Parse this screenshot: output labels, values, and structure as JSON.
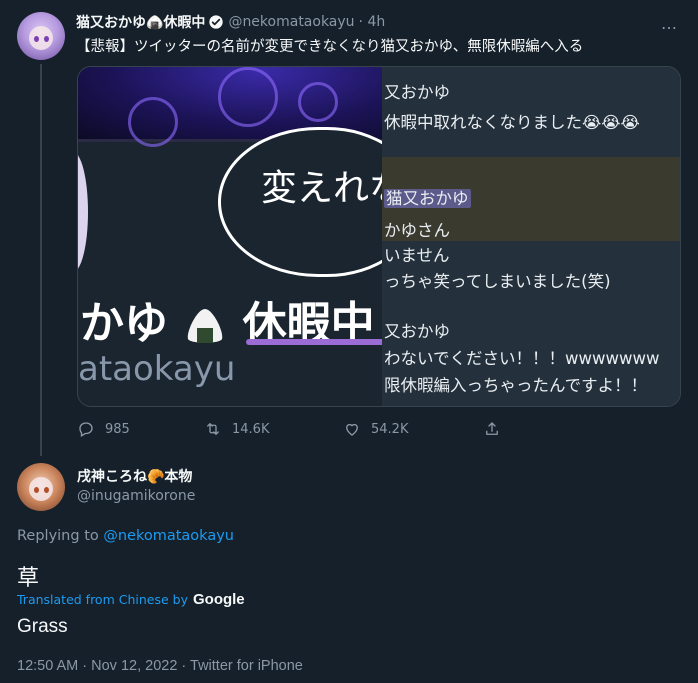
{
  "main_tweet": {
    "display_name": "猫又おかゆ🍙休暇中",
    "handle": "@nekomataokayu",
    "time": "· 4h",
    "text": "【悲報】ツイッターの名前が変更できなくなり猫又おかゆ、無限休暇編へ入る",
    "more_icon": "…",
    "media": {
      "left_panel": {
        "speech_bubble_text": "変えれな",
        "big_name": "かゆ",
        "big_name_suffix": "休暇中",
        "romaji": "ataokayu"
      },
      "right_panel": {
        "lines": [
          "又おかゆ",
          "休暇中取れなくなりました😭😭😭",
          "猫又おかゆ",
          "かゆさん",
          "いません",
          "っちゃ笑ってしまいました(笑)",
          "又おかゆ",
          "わないでください！！！wwwwwww",
          "限休暇編入っちゃったんですよ！！"
        ]
      }
    },
    "actions": {
      "reply_count": "985",
      "retweet_count": "14.6K",
      "like_count": "54.2K"
    }
  },
  "reply_tweet": {
    "display_name": "戌神ころね🥐本物",
    "handle": "@inugamikorone",
    "replying_to_label": "Replying to",
    "replying_to_handle": "@nekomataokayu",
    "text": "草",
    "translated_label": "Translated from Chinese by",
    "translator": "Google",
    "translation": "Grass",
    "timestamp": "12:50 AM · Nov 12, 2022 · Twitter for iPhone"
  },
  "colors": {
    "background": "#15202b",
    "accent": "#1d9bf0",
    "muted_text": "#8b98a5"
  }
}
